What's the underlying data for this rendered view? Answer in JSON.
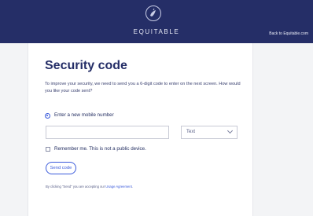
{
  "header": {
    "brand": "EQUITABLE",
    "back_link": "Back to Equitable.com",
    "logo_icon": "equitable-emblem-icon",
    "background": "#252e67"
  },
  "form": {
    "title": "Security code",
    "description": "To improve your security, we need to send you a 6-digit code to enter on the next screen. How would you like your code sent?",
    "radio_label": "Enter a new mobile number",
    "phone_value": "",
    "method_value": "Text",
    "remember_label": "Remember me. This is not a public device.",
    "send_label": "Send code",
    "legal_prefix": "By clicking \"Send\" you are accepting our ",
    "legal_link": "Usage Agreement",
    "legal_suffix": ".",
    "accent": "#3b5bdb"
  }
}
